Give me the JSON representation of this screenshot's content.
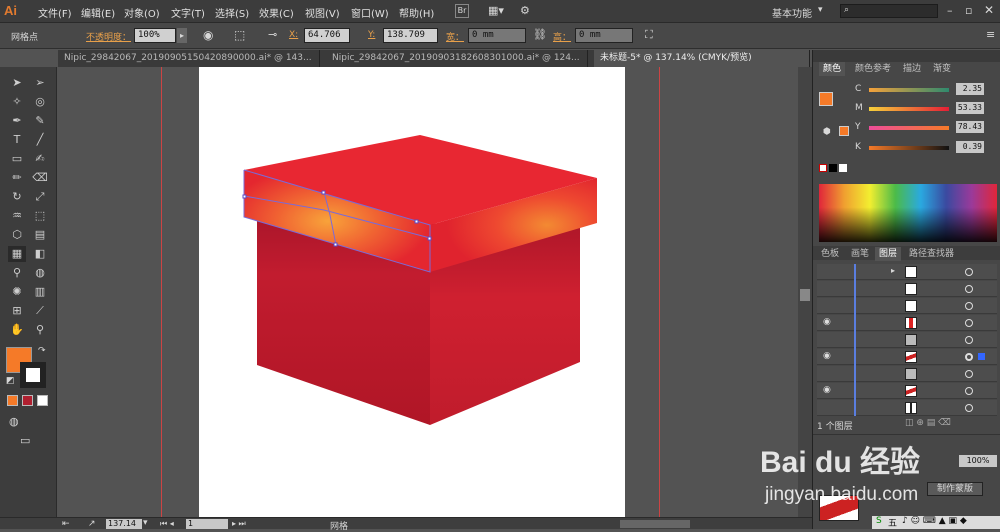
{
  "app": {
    "logo": "Ai",
    "workspace": "基本功能"
  },
  "menu": [
    "文件(F)",
    "编辑(E)",
    "对象(O)",
    "文字(T)",
    "选择(S)",
    "效果(C)",
    "视图(V)",
    "窗口(W)",
    "帮助(H)"
  ],
  "control": {
    "tool_name": "网格点",
    "opacity_label": "不透明度：",
    "opacity": "100%",
    "x_label": "X:",
    "x": "64.706",
    "y_label": "Y:",
    "y": "138.709",
    "w_label": "宽：",
    "w": "0 mm",
    "h_label": "高：",
    "h": "0 mm"
  },
  "tabs": [
    "Nipic_29842067_20190905150420890000.ai* @ 143...",
    "Nipic_29842067_20190903182608301000.ai* @ 124...",
    "未标题-5* @ 137.14% (CMYK/预览)"
  ],
  "color_panel": {
    "tabs": [
      "颜色",
      "颜色参考",
      "描边",
      "渐变"
    ],
    "channels": [
      {
        "label": "C",
        "value": "2.35"
      },
      {
        "label": "M",
        "value": "53.33"
      },
      {
        "label": "Y",
        "value": "78.43"
      },
      {
        "label": "K",
        "value": "0.39"
      }
    ],
    "fill_color": "#f57a28"
  },
  "layers_panel": {
    "tabs": [
      "色板",
      "画笔",
      "图层",
      "路径查找器"
    ],
    "footer": "1 个图层"
  },
  "bottom": {
    "zoom": "137.14",
    "page": "1",
    "status": "网格"
  },
  "watermark": {
    "brand": "Bai du 经验",
    "url": "jingyan.baidu.com"
  },
  "bottom_right": {
    "make_mask": "制作蒙版"
  }
}
